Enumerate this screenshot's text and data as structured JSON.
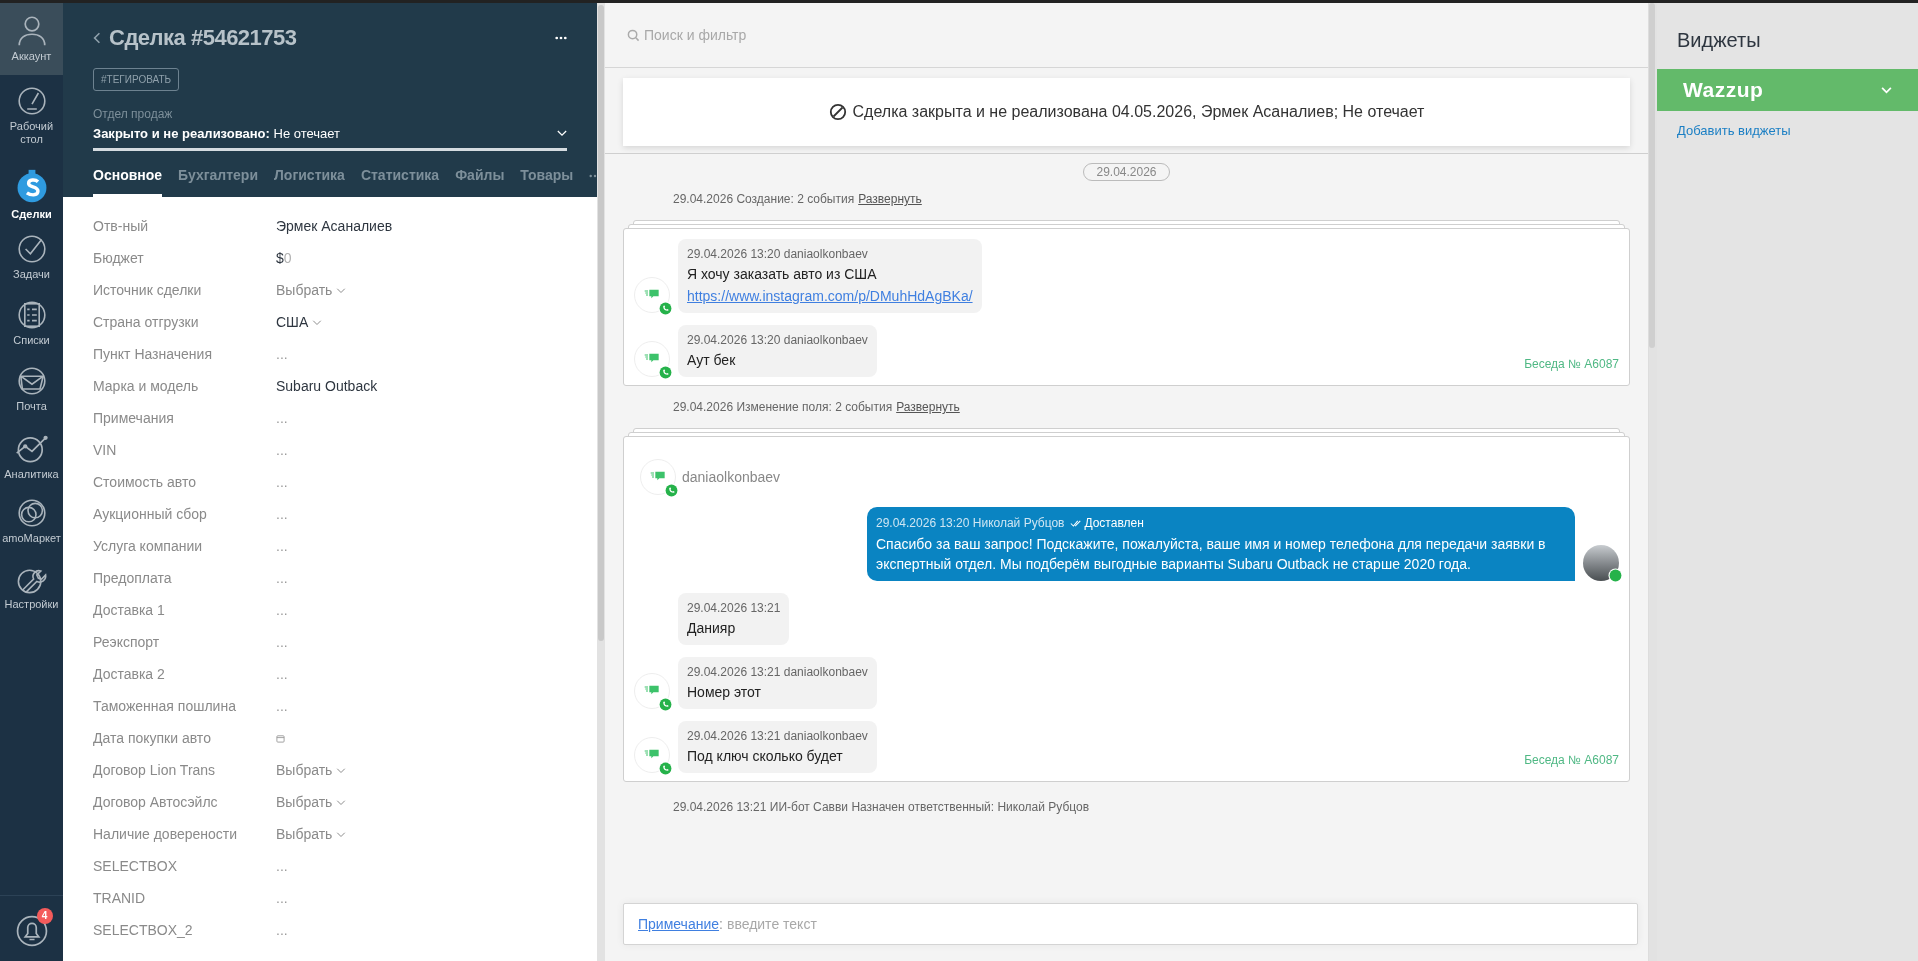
{
  "nav": {
    "items": [
      {
        "label": "Аккаунт",
        "kind": "account",
        "selected": false
      },
      {
        "label": "Рабочий стол",
        "kind": "dashboard",
        "selected": false
      },
      {
        "label": "Сделки",
        "kind": "deals",
        "selected": true
      },
      {
        "label": "Задачи",
        "kind": "tasks",
        "selected": false
      },
      {
        "label": "Списки",
        "kind": "lists",
        "selected": false
      },
      {
        "label": "Почта",
        "kind": "mail",
        "selected": false
      },
      {
        "label": "Аналитика",
        "kind": "analytics",
        "selected": false
      },
      {
        "label": "amoМаркет",
        "kind": "market",
        "selected": false
      },
      {
        "label": "Настройки",
        "kind": "settings",
        "selected": false
      }
    ],
    "notifications": {
      "badge": "4"
    }
  },
  "deal": {
    "title": "Сделка #54621753",
    "tag_button": "#ТЕГИРОВАТЬ",
    "pipeline": "Отдел продаж",
    "status": "**Закрыто и не реализовано:** Не отечает",
    "tabs": [
      {
        "label": "Основное",
        "selected": true
      },
      {
        "label": "Бухгалтери",
        "selected": false
      },
      {
        "label": "Логистика",
        "selected": false
      },
      {
        "label": "Статистика",
        "selected": false
      },
      {
        "label": "Файлы",
        "selected": false
      },
      {
        "label": "Товары",
        "selected": false
      }
    ],
    "fields": [
      {
        "label": "Отв-ный",
        "kind": "text",
        "value": "Эрмек Асаналиев"
      },
      {
        "label": "Бюджет",
        "kind": "money",
        "currency": "$",
        "value": "0"
      },
      {
        "label": "Источник сделки",
        "kind": "select",
        "placeholder": "Выбрать"
      },
      {
        "label": "Страна отгрузки",
        "kind": "select_set",
        "value": "США"
      },
      {
        "label": "Пункт Назначения",
        "kind": "empty",
        "placeholder": "..."
      },
      {
        "label": "Марка и модель",
        "kind": "text",
        "value": "Subaru Outback"
      },
      {
        "label": "Примечания",
        "kind": "empty",
        "placeholder": "..."
      },
      {
        "label": "VIN",
        "kind": "empty",
        "placeholder": "..."
      },
      {
        "label": "Стоимость авто",
        "kind": "empty",
        "placeholder": "..."
      },
      {
        "label": "Аукционный сбор",
        "kind": "empty",
        "placeholder": "..."
      },
      {
        "label": "Услуга компании",
        "kind": "empty",
        "placeholder": "..."
      },
      {
        "label": "Предоплата",
        "kind": "empty",
        "placeholder": "..."
      },
      {
        "label": "Доставка 1",
        "kind": "empty",
        "placeholder": "..."
      },
      {
        "label": "Реэкспорт",
        "kind": "empty",
        "placeholder": "..."
      },
      {
        "label": "Доставка 2",
        "kind": "empty",
        "placeholder": "..."
      },
      {
        "label": "Таможенная пошлина",
        "kind": "empty",
        "placeholder": "..."
      },
      {
        "label": "Дата покупки авто",
        "kind": "date"
      },
      {
        "label": "Договор Lion Trans",
        "kind": "select",
        "placeholder": "Выбрать"
      },
      {
        "label": "Договор Автосэйлс",
        "kind": "select",
        "placeholder": "Выбрать"
      },
      {
        "label": "Наличие доверености",
        "kind": "select",
        "placeholder": "Выбрать"
      },
      {
        "label": "SELECTBOX",
        "kind": "empty",
        "placeholder": "..."
      },
      {
        "label": "TRANID",
        "kind": "empty",
        "placeholder": "..."
      },
      {
        "label": "SELECTBOX_2",
        "kind": "empty",
        "placeholder": "..."
      }
    ]
  },
  "feed": {
    "search": {
      "placeholder": "Поиск и фильтр"
    },
    "closed_banner": "Сделка закрыта и не реализована 04.05.2026, Эрмек Асаналиев; Не отечает",
    "date_chip": "29.04.2026",
    "events": [
      {
        "kind": "summary",
        "text": "29.04.2026 Создание: 2 события",
        "link": "Развернуть"
      },
      {
        "kind": "chat",
        "conversation": "Беседа № A6087",
        "messages": [
          {
            "kind": "in",
            "avatar": true,
            "meta": "29.04.2026 13:20 daniaolkonbaev",
            "text": "Я хочу заказать авто из США",
            "link": "https://www.instagram.com/p/DMuhHdAgBKa/"
          },
          {
            "kind": "in",
            "avatar": true,
            "meta": "29.04.2026 13:20 daniaolkonbaev",
            "text": "Аут бек"
          }
        ]
      },
      {
        "kind": "summary",
        "text": "29.04.2026 Изменение поля: 2 события",
        "link": "Развернуть"
      },
      {
        "kind": "chat",
        "header": "daniaolkonbaev",
        "conversation": "Беседа № A6087",
        "messages": [
          {
            "kind": "out",
            "avatar": true,
            "meta": "29.04.2026 13:20 Николай Рубцов",
            "status": "Доставлен",
            "text": "Спасибо за ваш запрос! Подскажите, пожалуйста, ваше имя и номер телефона для передачи заявки в экспертный отдел. Мы подберём выгодные варианты Subaru Outback не старше 2020 года."
          },
          {
            "kind": "in",
            "avatar": false,
            "meta": "29.04.2026 13:21",
            "text": "Данияр"
          },
          {
            "kind": "in",
            "avatar": true,
            "meta": "29.04.2026 13:21 daniaolkonbaev",
            "text": "Номер этот"
          },
          {
            "kind": "in",
            "avatar": true,
            "meta": "29.04.2026 13:21 daniaolkonbaev",
            "text": "Под ключ сколько будет"
          }
        ]
      },
      {
        "kind": "system",
        "text": "29.04.2026 13:21 ИИ-бот Савви Назначен ответственный: Николай Рубцов"
      }
    ],
    "note": {
      "label": "Примечание",
      "separator": ":",
      "placeholder": "введите текст"
    }
  },
  "widgets": {
    "title": "Виджеты",
    "items": [
      {
        "name": "Wazzup",
        "expanded": false
      }
    ],
    "add_link": "Добавить виджеты"
  }
}
